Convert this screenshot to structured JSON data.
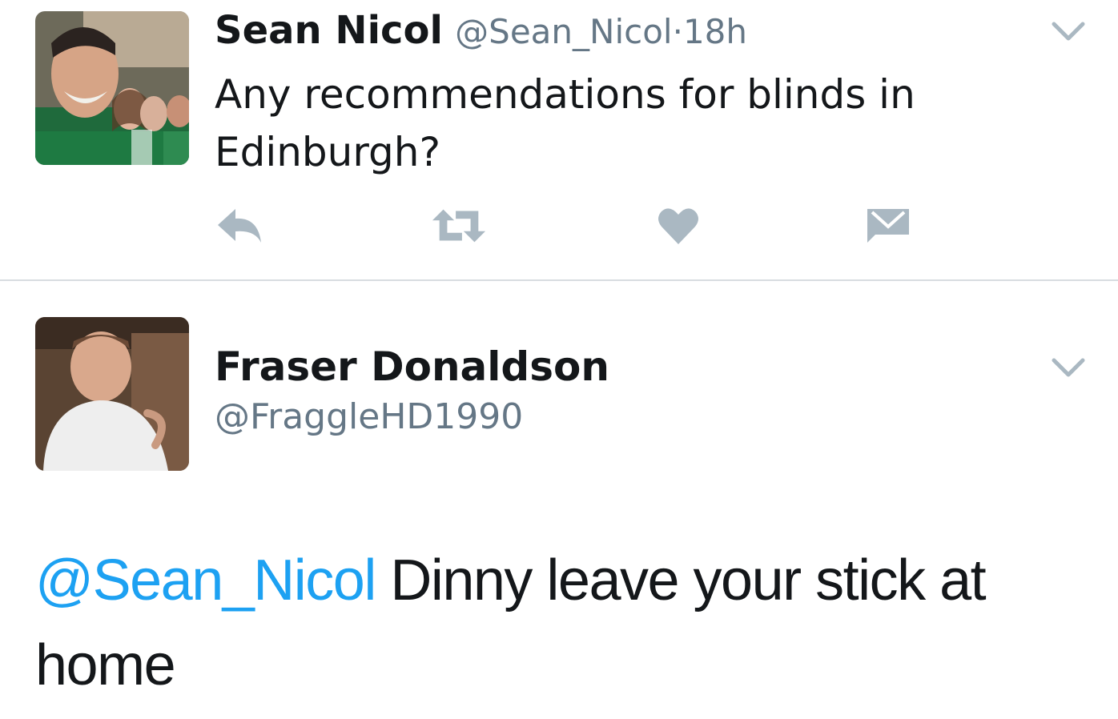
{
  "tweet": {
    "author_name": "Sean Nicol",
    "author_handle": "@Sean_Nicol",
    "separator": "·",
    "time": "18h",
    "text": "Any recommendations for blinds in Edinburgh?",
    "avatar": "group-selfie-photo",
    "menu_icon": "chevron-down-icon",
    "actions": [
      {
        "name": "reply",
        "icon": "reply-icon"
      },
      {
        "name": "retweet",
        "icon": "retweet-icon"
      },
      {
        "name": "like",
        "icon": "heart-icon"
      },
      {
        "name": "message",
        "icon": "envelope-icon"
      }
    ]
  },
  "reply": {
    "author_name": "Fraser Donaldson",
    "author_handle": "@FraggleHD1990",
    "avatar": "man-portrait-photo",
    "menu_icon": "chevron-down-icon",
    "mention": "@Sean_Nicol",
    "text": "Dinny leave your stick at home"
  },
  "colors": {
    "text": "#14171a",
    "secondary": "#657786",
    "icon": "#aab8c2",
    "mention": "#1da1f2",
    "divider": "#d8dce0"
  }
}
